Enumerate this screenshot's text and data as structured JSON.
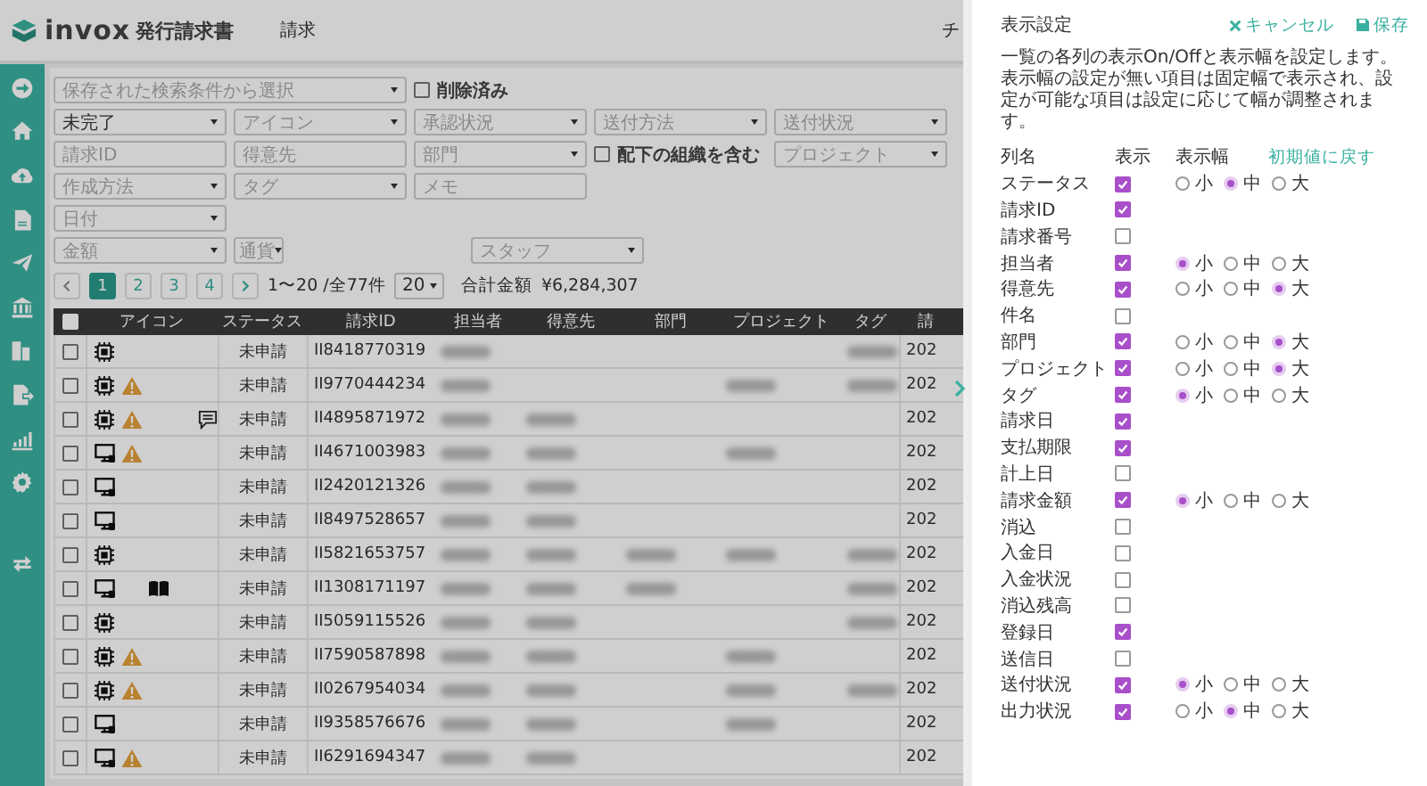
{
  "header": {
    "logo": "invox",
    "product": "発行請求書",
    "nav": "請求",
    "cut_item": "チ"
  },
  "filters": {
    "saved_search": {
      "placeholder": "保存された検索条件から選択"
    },
    "deleted": {
      "label": "削除済み",
      "checked": false
    },
    "rows": [
      [
        {
          "kind": "dropdown",
          "value": "未完了"
        },
        {
          "kind": "dropdown",
          "placeholder": "アイコン"
        },
        {
          "kind": "dropdown",
          "placeholder": "承認状況"
        },
        {
          "kind": "dropdown",
          "placeholder": "送付方法"
        },
        {
          "kind": "dropdown",
          "placeholder": "送付状況"
        }
      ],
      [
        {
          "kind": "input",
          "placeholder": "請求ID"
        },
        {
          "kind": "input",
          "placeholder": "得意先"
        },
        {
          "kind": "dropdown",
          "placeholder": "部門"
        },
        {
          "kind": "checkbox",
          "label": "配下の組織を含む",
          "checked": false
        },
        {
          "kind": "dropdown",
          "placeholder": "プロジェクト"
        }
      ],
      [
        {
          "kind": "dropdown",
          "placeholder": "作成方法"
        },
        {
          "kind": "dropdown",
          "placeholder": "タグ"
        },
        {
          "kind": "input",
          "placeholder": "メモ"
        }
      ],
      [
        {
          "kind": "dropdown",
          "placeholder": "日付"
        }
      ],
      [
        {
          "kind": "dropdown",
          "placeholder": "金額"
        },
        {
          "kind": "mini-dropdown",
          "placeholder": "通貨"
        },
        {
          "kind": "spacer"
        },
        {
          "kind": "dropdown",
          "placeholder": "スタッフ"
        }
      ]
    ]
  },
  "pagination": {
    "pages": [
      {
        "label": "1",
        "selected": true
      },
      {
        "label": "2",
        "selected": false
      },
      {
        "label": "3",
        "selected": false
      },
      {
        "label": "4",
        "selected": false
      }
    ],
    "range": "1〜20 /全77件",
    "page_size": "20",
    "total_label": "合計金額",
    "total": "¥6,284,307"
  },
  "table": {
    "select_all": {
      "checked": false
    },
    "columns": [
      "アイコン",
      "ステータス",
      "請求ID",
      "担当者",
      "得意先",
      "部門",
      "プロジェクト",
      "タグ",
      "請"
    ],
    "rows": [
      {
        "checked": false,
        "kind": "chip",
        "warning": false,
        "book": false,
        "comment": false,
        "status": "未申請",
        "id": "II8418770319",
        "blurred": [
          true,
          false,
          false,
          false,
          true
        ],
        "column_9": "202"
      },
      {
        "checked": false,
        "kind": "chip",
        "warning": true,
        "book": false,
        "comment": false,
        "status": "未申請",
        "id": "II9770444234",
        "blurred": [
          true,
          false,
          false,
          true,
          true
        ],
        "column_9": "202"
      },
      {
        "checked": false,
        "kind": "chip",
        "warning": true,
        "book": false,
        "comment": true,
        "status": "未申請",
        "id": "II4895871972",
        "blurred": [
          true,
          true,
          false,
          false,
          false
        ],
        "column_9": "202"
      },
      {
        "checked": false,
        "kind": "monitor",
        "warning": true,
        "book": false,
        "comment": false,
        "status": "未申請",
        "id": "II4671003983",
        "blurred": [
          true,
          true,
          false,
          true,
          false
        ],
        "column_9": "202"
      },
      {
        "checked": false,
        "kind": "monitor",
        "warning": false,
        "book": false,
        "comment": false,
        "status": "未申請",
        "id": "II2420121326",
        "blurred": [
          true,
          true,
          false,
          false,
          false
        ],
        "column_9": "202"
      },
      {
        "checked": false,
        "kind": "monitor",
        "warning": false,
        "book": false,
        "comment": false,
        "status": "未申請",
        "id": "II8497528657",
        "blurred": [
          true,
          true,
          false,
          false,
          false
        ],
        "column_9": "202"
      },
      {
        "checked": false,
        "kind": "chip",
        "warning": false,
        "book": false,
        "comment": false,
        "status": "未申請",
        "id": "II5821653757",
        "blurred": [
          true,
          true,
          true,
          true,
          true
        ],
        "column_9": "202"
      },
      {
        "checked": false,
        "kind": "monitor",
        "warning": false,
        "book": true,
        "comment": false,
        "status": "未申請",
        "id": "II1308171197",
        "blurred": [
          true,
          true,
          true,
          false,
          true
        ],
        "column_9": "202"
      },
      {
        "checked": false,
        "kind": "chip",
        "warning": false,
        "book": false,
        "comment": false,
        "status": "未申請",
        "id": "II5059115526",
        "blurred": [
          true,
          true,
          false,
          false,
          true
        ],
        "column_9": "202"
      },
      {
        "checked": false,
        "kind": "chip",
        "warning": true,
        "book": false,
        "comment": false,
        "status": "未申請",
        "id": "II7590587898",
        "blurred": [
          true,
          true,
          false,
          true,
          false
        ],
        "column_9": "202"
      },
      {
        "checked": false,
        "kind": "chip",
        "warning": true,
        "book": false,
        "comment": false,
        "status": "未申請",
        "id": "II0267954034",
        "blurred": [
          true,
          true,
          false,
          true,
          true
        ],
        "column_9": "202"
      },
      {
        "checked": false,
        "kind": "monitor",
        "warning": false,
        "book": false,
        "comment": false,
        "status": "未申請",
        "id": "II9358576676",
        "blurred": [
          true,
          true,
          false,
          true,
          false
        ],
        "column_9": "202"
      },
      {
        "checked": false,
        "kind": "monitor",
        "warning": true,
        "book": false,
        "comment": false,
        "status": "未申請",
        "id": "II6291694347",
        "blurred": [
          true,
          true,
          false,
          false,
          false
        ],
        "column_9": "202"
      }
    ]
  },
  "panel": {
    "title": "表示設定",
    "cancel": "キャンセル",
    "save": "保存",
    "description": [
      "一覧の各列の表示On/Offと表示幅を設定します。",
      "表示幅の設定が無い項目は固定幅で表示され、設定が可能な項目は設定に応じて幅が調整されます。"
    ],
    "headers": {
      "name": "列名",
      "show": "表示",
      "width": "表示幅",
      "reset": "初期値に戻す"
    },
    "columns": [
      {
        "name": "ステータス",
        "shown": true,
        "widths": [
          {
            "label": "小",
            "selected": false
          },
          {
            "label": "中",
            "selected": true
          },
          {
            "label": "大",
            "selected": false
          }
        ]
      },
      {
        "name": "請求ID",
        "shown": true
      },
      {
        "name": "請求番号",
        "shown": false
      },
      {
        "name": "担当者",
        "shown": true,
        "widths": [
          {
            "label": "小",
            "selected": true
          },
          {
            "label": "中",
            "selected": false
          },
          {
            "label": "大",
            "selected": false
          }
        ]
      },
      {
        "name": "得意先",
        "shown": true,
        "widths": [
          {
            "label": "小",
            "selected": false
          },
          {
            "label": "中",
            "selected": false
          },
          {
            "label": "大",
            "selected": true
          }
        ]
      },
      {
        "name": "件名",
        "shown": false
      },
      {
        "name": "部門",
        "shown": true,
        "widths": [
          {
            "label": "小",
            "selected": false
          },
          {
            "label": "中",
            "selected": false
          },
          {
            "label": "大",
            "selected": true
          }
        ]
      },
      {
        "name": "プロジェクト",
        "shown": true,
        "widths": [
          {
            "label": "小",
            "selected": false
          },
          {
            "label": "中",
            "selected": false
          },
          {
            "label": "大",
            "selected": true
          }
        ]
      },
      {
        "name": "タグ",
        "shown": true,
        "widths": [
          {
            "label": "小",
            "selected": true
          },
          {
            "label": "中",
            "selected": false
          },
          {
            "label": "大",
            "selected": false
          }
        ]
      },
      {
        "name": "請求日",
        "shown": true
      },
      {
        "name": "支払期限",
        "shown": true
      },
      {
        "name": "計上日",
        "shown": false
      },
      {
        "name": "請求金額",
        "shown": true,
        "widths": [
          {
            "label": "小",
            "selected": true
          },
          {
            "label": "中",
            "selected": false
          },
          {
            "label": "大",
            "selected": false
          }
        ]
      },
      {
        "name": "消込",
        "shown": false
      },
      {
        "name": "入金日",
        "shown": false
      },
      {
        "name": "入金状況",
        "shown": false
      },
      {
        "name": "消込残高",
        "shown": false
      },
      {
        "name": "登録日",
        "shown": true
      },
      {
        "name": "送信日",
        "shown": false
      },
      {
        "name": "送付状況",
        "shown": true,
        "widths": [
          {
            "label": "小",
            "selected": true
          },
          {
            "label": "中",
            "selected": false
          },
          {
            "label": "大",
            "selected": false
          }
        ]
      },
      {
        "name": "出力状況",
        "shown": true,
        "widths": [
          {
            "label": "小",
            "selected": false
          },
          {
            "label": "中",
            "selected": true
          },
          {
            "label": "大",
            "selected": false
          }
        ]
      }
    ]
  }
}
